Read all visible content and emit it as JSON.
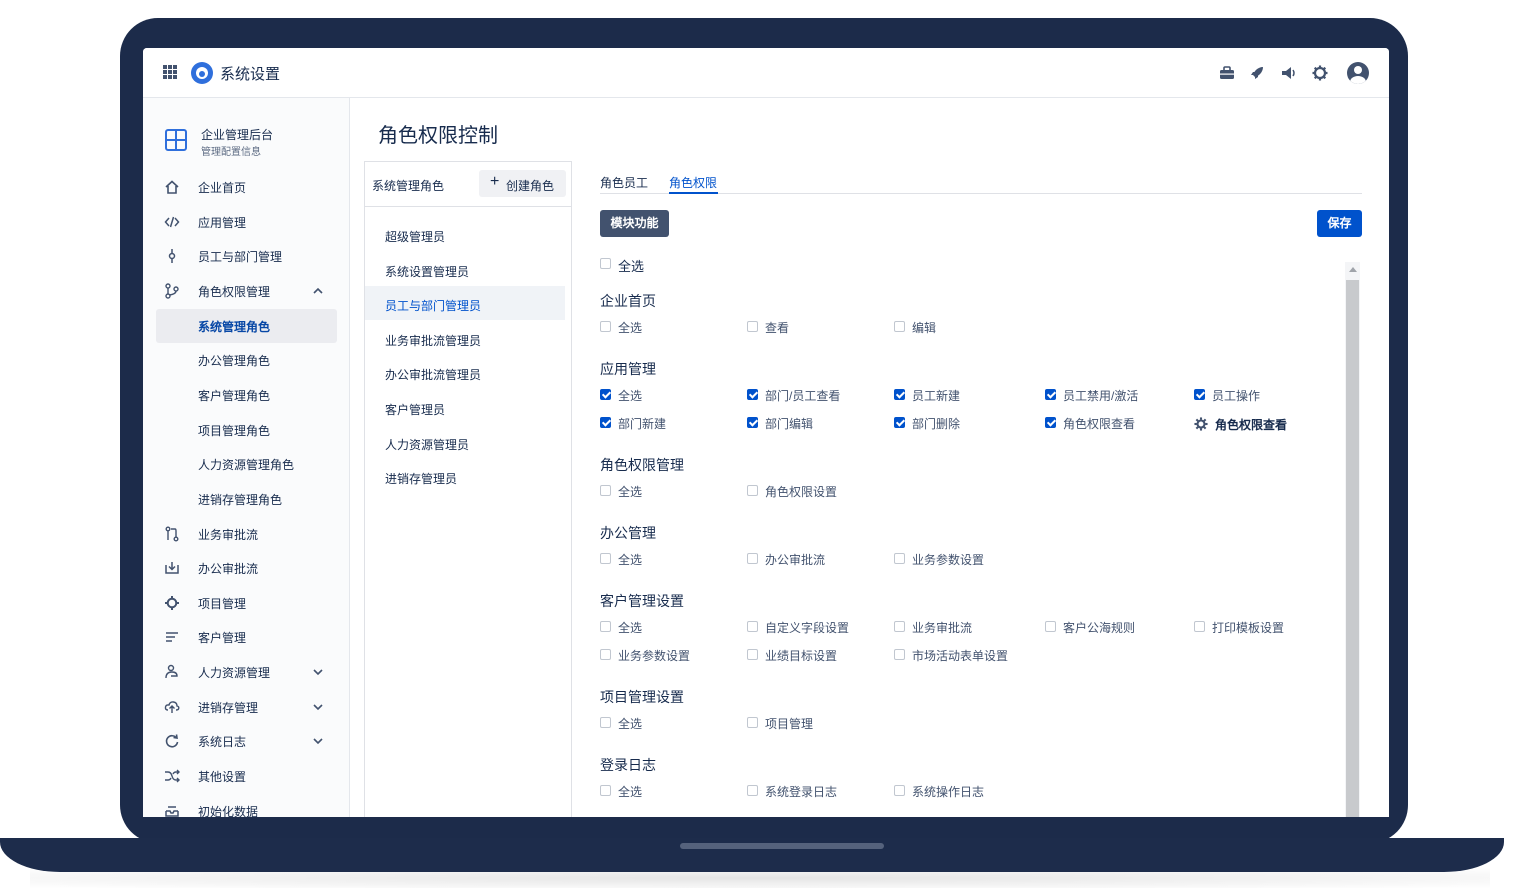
{
  "app": {
    "title": "系统设置"
  },
  "org": {
    "name": "企业管理后台",
    "subtitle": "管理配置信息"
  },
  "sidebar": {
    "items": [
      {
        "label": "企业首页",
        "icon": "home-icon"
      },
      {
        "label": "应用管理",
        "icon": "code-icon"
      },
      {
        "label": "员工与部门管理",
        "icon": "commit-icon"
      },
      {
        "label": "角色权限管理",
        "icon": "branch-icon",
        "expanded": true
      },
      {
        "label": "业务审批流",
        "icon": "pull-request-icon"
      },
      {
        "label": "办公审批流",
        "icon": "download-icon"
      },
      {
        "label": "项目管理",
        "icon": "gear-icon"
      },
      {
        "label": "客户管理",
        "icon": "list-icon"
      },
      {
        "label": "人力资源管理",
        "icon": "people-icon",
        "expandable": true
      },
      {
        "label": "进销存管理",
        "icon": "cloud-upload-icon",
        "expandable": true
      },
      {
        "label": "系统日志",
        "icon": "refresh-icon",
        "expandable": true
      },
      {
        "label": "其他设置",
        "icon": "shuffle-icon"
      },
      {
        "label": "初始化数据",
        "icon": "inbox-icon"
      }
    ],
    "subitems": [
      "系统管理角色",
      "办公管理角色",
      "客户管理角色",
      "项目管理角色",
      "人力资源管理角色",
      "进销存管理角色"
    ]
  },
  "page": {
    "title": "角色权限控制"
  },
  "roles_panel": {
    "header": "系统管理角色",
    "create_label": "创建角色",
    "roles": [
      "超级管理员",
      "系统设置管理员",
      "员工与部门管理员",
      "业务审批流管理员",
      "办公审批流管理员",
      "客户管理员",
      "人力资源管理员",
      "进销存管理员"
    ],
    "selected": "员工与部门管理员"
  },
  "tabs": [
    "角色员工",
    "角色权限"
  ],
  "active_tab": "角色权限",
  "buttons": {
    "module": "模块功能",
    "save": "保存"
  },
  "select_all_top": "全选",
  "sections": [
    {
      "title": "企业首页",
      "rows": [
        [
          {
            "label": "全选",
            "checked": false
          },
          {
            "label": "查看",
            "checked": false
          },
          {
            "label": "编辑",
            "checked": false
          }
        ]
      ]
    },
    {
      "title": "应用管理",
      "rows": [
        [
          {
            "label": "全选",
            "checked": true
          },
          {
            "label": "部门/员工查看",
            "checked": true
          },
          {
            "label": "员工新建",
            "checked": true
          },
          {
            "label": "员工禁用/激活",
            "checked": true
          },
          {
            "label": "员工操作",
            "checked": true
          }
        ],
        [
          {
            "label": "部门新建",
            "checked": true
          },
          {
            "label": "部门编辑",
            "checked": true
          },
          {
            "label": "部门删除",
            "checked": true
          },
          {
            "label": "角色权限查看",
            "checked": true
          },
          {
            "label": "角色权限查看",
            "gear": true
          }
        ]
      ]
    },
    {
      "title": "角色权限管理",
      "rows": [
        [
          {
            "label": "全选",
            "checked": false
          },
          {
            "label": "角色权限设置",
            "checked": false
          }
        ]
      ]
    },
    {
      "title": "办公管理",
      "rows": [
        [
          {
            "label": "全选",
            "checked": false
          },
          {
            "label": "办公审批流",
            "checked": false
          },
          {
            "label": "业务参数设置",
            "checked": false
          }
        ]
      ]
    },
    {
      "title": "客户管理设置",
      "rows": [
        [
          {
            "label": "全选",
            "checked": false
          },
          {
            "label": "自定义字段设置",
            "checked": false
          },
          {
            "label": "业务审批流",
            "checked": false
          },
          {
            "label": "客户公海规则",
            "checked": false
          },
          {
            "label": "打印模板设置",
            "checked": false
          }
        ],
        [
          {
            "label": "业务参数设置",
            "checked": false
          },
          {
            "label": "业绩目标设置",
            "checked": false
          },
          {
            "label": "市场活动表单设置",
            "checked": false
          }
        ]
      ]
    },
    {
      "title": "项目管理设置",
      "rows": [
        [
          {
            "label": "全选",
            "checked": false
          },
          {
            "label": "项目管理",
            "checked": false
          }
        ]
      ]
    },
    {
      "title": "登录日志",
      "rows": [
        [
          {
            "label": "全选",
            "checked": false
          },
          {
            "label": "系统登录日志",
            "checked": false
          },
          {
            "label": "系统操作日志",
            "checked": false
          }
        ]
      ]
    }
  ],
  "colors": {
    "frame": "#1c2b4a",
    "accent": "#0052cc",
    "module_button": "#42526e"
  }
}
